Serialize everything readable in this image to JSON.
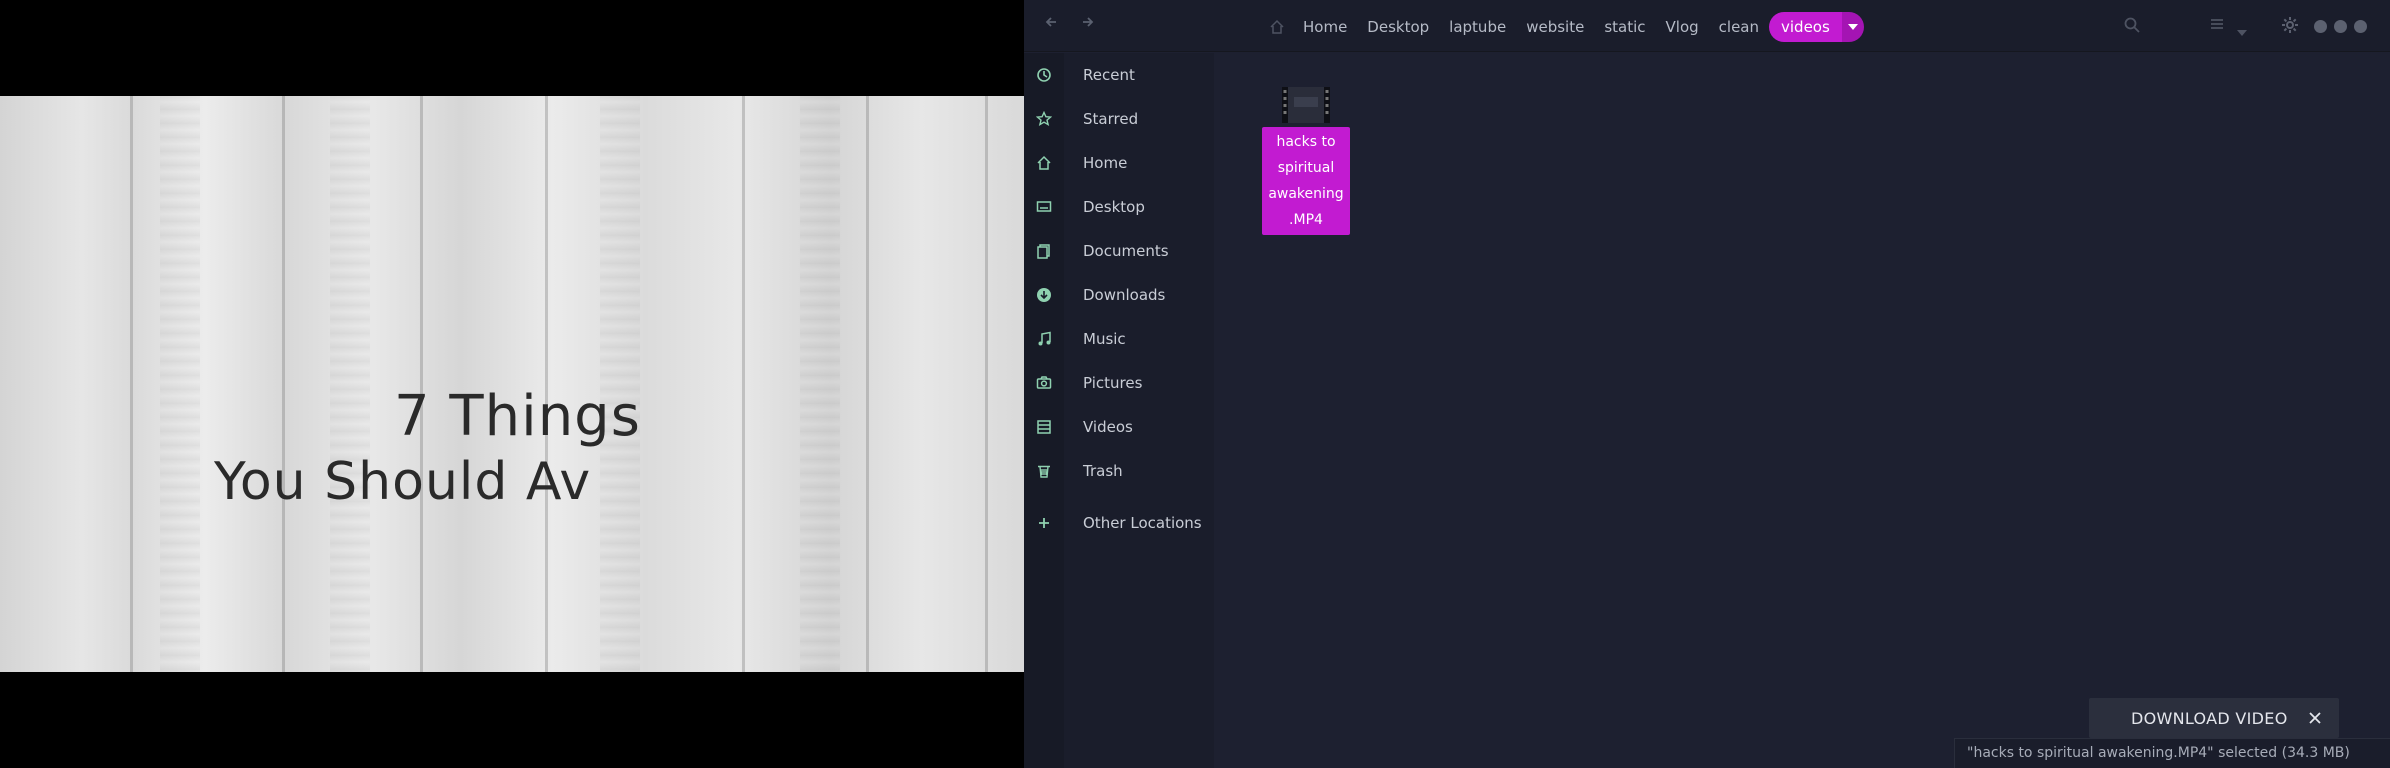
{
  "video": {
    "line1": "7 Things",
    "line2": "You Should Av"
  },
  "headerbar": {
    "breadcrumbs": [
      "Home",
      "Desktop",
      "laptube",
      "website",
      "static",
      "Vlog",
      "clean"
    ],
    "active_crumb": "videos"
  },
  "sidebar": {
    "items": [
      {
        "label": "Recent",
        "icon": "clock-icon"
      },
      {
        "label": "Starred",
        "icon": "star-icon"
      },
      {
        "label": "Home",
        "icon": "home-icon"
      },
      {
        "label": "Desktop",
        "icon": "desktop-icon"
      },
      {
        "label": "Documents",
        "icon": "documents-icon"
      },
      {
        "label": "Downloads",
        "icon": "download-icon"
      },
      {
        "label": "Music",
        "icon": "music-icon"
      },
      {
        "label": "Pictures",
        "icon": "camera-icon"
      },
      {
        "label": "Videos",
        "icon": "video-icon"
      },
      {
        "label": "Trash",
        "icon": "trash-icon"
      },
      {
        "label": "Other Locations",
        "icon": "plus-icon"
      }
    ]
  },
  "content": {
    "file": {
      "name_lines": [
        "hacks to",
        "spiritual",
        "awakening",
        ".MP4"
      ],
      "icon": "film-icon"
    }
  },
  "notice": {
    "text": "DOWNLOAD VIDEO"
  },
  "statusbar": {
    "text": "\"hacks to spiritual awakening.MP4\" selected (34.3 MB)"
  },
  "colors": {
    "accent": "#c21bd1",
    "sidebar_icon": "#8fd1b0",
    "background": "#1d2030"
  }
}
